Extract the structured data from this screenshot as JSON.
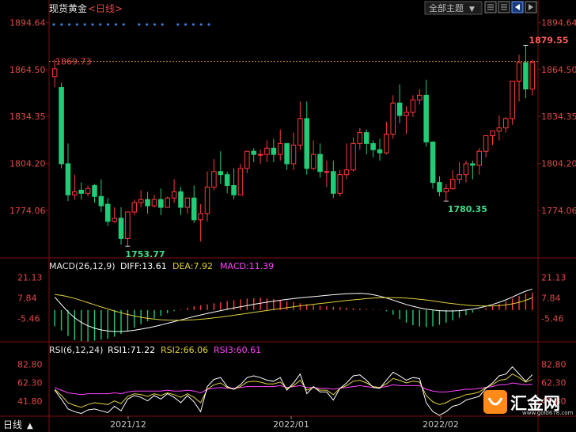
{
  "header": {
    "symbol": "现货黄金",
    "period": "<日线>",
    "theme_select": "全部主题",
    "theme_arrow": "▼"
  },
  "colors": {
    "up": "#ff3b3b",
    "down": "#22cc77",
    "axis_text": "#e04848",
    "dashed_ref": "#d88a30",
    "diff": "#ffffff",
    "dea": "#e0d040",
    "macd": "#ff44ff",
    "rsi1": "#ffffff",
    "rsi2": "#e0d040",
    "rsi3": "#ff44ff",
    "grid": "#7a1010",
    "blue_dots": "#3a78d8"
  },
  "price_panel": {
    "axis_labels": [
      "1894.64",
      "1864.50",
      "1834.35",
      "1804.20",
      "1774.06"
    ],
    "ref_label": "1869.73",
    "high_label": "1879.55",
    "low_label": "1753.77",
    "mid_low_label": "1780.35"
  },
  "macd_panel": {
    "title": "MACD(26,12,9)",
    "diff_label": "DIFF:13.61",
    "dea_label": "DEA:7.92",
    "macd_label": "MACD:11.39",
    "axis_labels": [
      "21.13",
      "7.84",
      "-5.46"
    ]
  },
  "rsi_panel": {
    "title": "RSI(6,12,24)",
    "rsi1_label": "RSI1:71.22",
    "rsi2_label": "RSI2:66.06",
    "rsi3_label": "RSI3:60.61",
    "axis_labels": [
      "82.80",
      "62.30",
      "41.80"
    ]
  },
  "xaxis": {
    "period_button": "日线",
    "period_arrow": "▲",
    "dates": [
      "2021/12",
      "2022/01",
      "2022/02"
    ]
  },
  "logo": {
    "name": "汇金网",
    "url": "www.gold678.com"
  },
  "chart_data": {
    "type": "candlestick",
    "price_range": [
      1744,
      1898
    ],
    "candles": [
      [
        1860,
        1871,
        1865,
        1853
      ],
      [
        1853,
        1856,
        1804,
        1801
      ],
      [
        1804,
        1817,
        1784,
        1780
      ],
      [
        1784,
        1797,
        1786,
        1781
      ],
      [
        1787,
        1792,
        1785,
        1781
      ],
      [
        1785,
        1790,
        1788,
        1783
      ],
      [
        1790,
        1791,
        1783,
        1779
      ],
      [
        1783,
        1794,
        1777,
        1773
      ],
      [
        1778,
        1782,
        1767,
        1764
      ],
      [
        1767,
        1776,
        1769,
        1766
      ],
      [
        1769,
        1776,
        1756,
        1752
      ],
      [
        1756,
        1772,
        1773,
        1751
      ],
      [
        1773,
        1781,
        1779,
        1771
      ],
      [
        1779,
        1787,
        1781,
        1776
      ],
      [
        1781,
        1786,
        1777,
        1772
      ],
      [
        1777,
        1784,
        1781,
        1776
      ],
      [
        1781,
        1788,
        1776,
        1771
      ],
      [
        1776,
        1783,
        1782,
        1776
      ],
      [
        1782,
        1794,
        1786,
        1779
      ],
      [
        1786,
        1789,
        1776,
        1771
      ],
      [
        1776,
        1778,
        1782,
        1772
      ],
      [
        1782,
        1790,
        1768,
        1766
      ],
      [
        1768,
        1778,
        1772,
        1754
      ],
      [
        1772,
        1799,
        1789,
        1767
      ],
      [
        1789,
        1807,
        1799,
        1787
      ],
      [
        1799,
        1812,
        1797,
        1791
      ],
      [
        1797,
        1799,
        1790,
        1785
      ],
      [
        1790,
        1801,
        1784,
        1781
      ],
      [
        1784,
        1804,
        1801,
        1784
      ],
      [
        1801,
        1811,
        1812,
        1798
      ],
      [
        1812,
        1814,
        1810,
        1805
      ],
      [
        1810,
        1813,
        1810,
        1804
      ],
      [
        1810,
        1819,
        1814,
        1805
      ],
      [
        1814,
        1820,
        1810,
        1805
      ],
      [
        1810,
        1826,
        1817,
        1806
      ],
      [
        1817,
        1817,
        1804,
        1800
      ],
      [
        1804,
        1824,
        1816,
        1800
      ],
      [
        1816,
        1844,
        1833,
        1813
      ],
      [
        1833,
        1844,
        1801,
        1797
      ],
      [
        1801,
        1819,
        1810,
        1800
      ],
      [
        1810,
        1817,
        1799,
        1795
      ],
      [
        1799,
        1806,
        1799,
        1789
      ],
      [
        1799,
        1806,
        1785,
        1782
      ],
      [
        1785,
        1800,
        1797,
        1783
      ],
      [
        1797,
        1817,
        1800,
        1794
      ],
      [
        1800,
        1821,
        1817,
        1799
      ],
      [
        1817,
        1827,
        1824,
        1813
      ],
      [
        1824,
        1826,
        1817,
        1810
      ],
      [
        1817,
        1819,
        1813,
        1808
      ],
      [
        1813,
        1820,
        1811,
        1806
      ],
      [
        1811,
        1831,
        1823,
        1810
      ],
      [
        1823,
        1848,
        1843,
        1820
      ],
      [
        1843,
        1855,
        1835,
        1830
      ],
      [
        1835,
        1841,
        1837,
        1823
      ],
      [
        1837,
        1848,
        1845,
        1834
      ],
      [
        1845,
        1852,
        1848,
        1842
      ],
      [
        1848,
        1858,
        1818,
        1815
      ],
      [
        1818,
        1818,
        1792,
        1788
      ],
      [
        1792,
        1796,
        1786,
        1783
      ],
      [
        1786,
        1791,
        1788,
        1780
      ],
      [
        1788,
        1800,
        1794,
        1787
      ],
      [
        1794,
        1805,
        1797,
        1791
      ],
      [
        1797,
        1806,
        1804,
        1792
      ],
      [
        1804,
        1806,
        1803,
        1794
      ],
      [
        1803,
        1814,
        1812,
        1797
      ],
      [
        1812,
        1821,
        1822,
        1808
      ],
      [
        1822,
        1824,
        1825,
        1816
      ],
      [
        1825,
        1835,
        1827,
        1819
      ],
      [
        1827,
        1834,
        1833,
        1824
      ],
      [
        1833,
        1855,
        1857,
        1829
      ],
      [
        1857,
        1874,
        1869,
        1844
      ],
      [
        1869,
        1880,
        1852,
        1846
      ],
      [
        1852,
        1871,
        1869,
        1848
      ]
    ],
    "macd": {
      "histogram": [
        -10.5,
        -13.2,
        -16.8,
        -19.5,
        -20.1,
        -20.4,
        -19.8,
        -19.2,
        -18.6,
        -17.3,
        -15.5,
        -13.6,
        -11.4,
        -9.2,
        -7.3,
        -5.4,
        -3.8,
        -2.1,
        -0.7,
        0.4,
        1.4,
        2.4,
        3.1,
        3.7,
        4.4,
        5.1,
        5.8,
        6.3,
        6.9,
        7.4,
        7.7,
        7.9,
        7.6,
        7.1,
        6.5,
        5.8,
        5.2,
        4.4,
        3.8,
        3.2,
        2.8,
        2.4,
        2.1,
        1.8,
        1.5,
        1.2,
        0.9,
        0.6,
        0.4,
        0.2,
        -0.8,
        -3.0,
        -5.8,
        -8.2,
        -9.8,
        -10.7,
        -11.0,
        -10.6,
        -9.6,
        -8.2,
        -6.7,
        -5.0,
        -3.3,
        -1.7,
        -0.2,
        1.2,
        2.6,
        4.0,
        5.6,
        7.4,
        9.2,
        10.5,
        11.39
      ],
      "diff": [
        8.4,
        3.5,
        -1.2,
        -5.0,
        -8.0,
        -10.2,
        -11.8,
        -12.9,
        -13.5,
        -13.9,
        -13.9,
        -13.6,
        -13.1,
        -12.4,
        -11.6,
        -10.7,
        -9.7,
        -8.6,
        -7.5,
        -6.4,
        -5.3,
        -4.2,
        -3.2,
        -2.2,
        -1.3,
        -0.4,
        0.5,
        1.3,
        2.1,
        2.9,
        3.7,
        4.4,
        5.1,
        5.7,
        6.3,
        6.9,
        7.4,
        7.9,
        8.3,
        8.7,
        9.1,
        9.5,
        9.9,
        10.2,
        10.5,
        10.7,
        10.8,
        10.5,
        9.9,
        9.0,
        7.8,
        6.4,
        5.0,
        3.6,
        2.4,
        1.4,
        0.6,
        0.0,
        -0.4,
        -0.6,
        -0.6,
        -0.4,
        0.0,
        0.6,
        1.4,
        2.4,
        3.6,
        5.0,
        6.6,
        8.4,
        10.4,
        12.2,
        13.61
      ],
      "dea": [
        10.0,
        9.5,
        8.6,
        7.5,
        6.2,
        4.8,
        3.4,
        2.0,
        0.7,
        -0.6,
        -1.8,
        -2.9,
        -3.9,
        -4.7,
        -5.4,
        -5.9,
        -6.3,
        -6.5,
        -6.6,
        -6.6,
        -6.5,
        -6.3,
        -6.0,
        -5.6,
        -5.1,
        -4.6,
        -4.0,
        -3.4,
        -2.8,
        -2.2,
        -1.5,
        -0.9,
        -0.3,
        0.3,
        0.9,
        1.5,
        2.1,
        2.7,
        3.2,
        3.7,
        4.2,
        4.7,
        5.2,
        5.7,
        6.2,
        6.6,
        7.0,
        7.4,
        7.7,
        7.9,
        8.0,
        8.0,
        7.9,
        7.7,
        7.4,
        7.0,
        6.5,
        5.9,
        5.3,
        4.7,
        4.1,
        3.6,
        3.2,
        2.9,
        2.7,
        2.6,
        2.7,
        2.9,
        3.3,
        4.0,
        5.0,
        6.3,
        7.92
      ],
      "range": [
        -17,
        24
      ]
    },
    "rsi": {
      "rsi1": [
        54,
        44,
        33,
        30,
        28,
        32,
        33,
        31,
        29,
        36,
        31,
        44,
        48,
        46,
        42,
        48,
        44,
        50,
        46,
        40,
        48,
        41,
        30,
        58,
        66,
        68,
        58,
        55,
        60,
        68,
        70,
        68,
        65,
        64,
        68,
        54,
        62,
        72,
        50,
        58,
        52,
        52,
        43,
        56,
        62,
        70,
        71,
        65,
        57,
        56,
        65,
        74,
        70,
        65,
        68,
        67,
        40,
        30,
        26,
        30,
        36,
        38,
        43,
        45,
        47,
        56,
        62,
        70,
        72,
        80,
        72,
        64,
        71.2
      ],
      "rsi2": [
        55,
        48,
        40,
        37,
        35,
        38,
        40,
        39,
        38,
        42,
        39,
        47,
        50,
        49,
        47,
        50,
        48,
        51,
        49,
        46,
        50,
        46,
        40,
        55,
        60,
        62,
        57,
        55,
        58,
        63,
        64,
        63,
        61,
        61,
        63,
        56,
        59,
        65,
        54,
        57,
        54,
        54,
        49,
        56,
        59,
        64,
        65,
        62,
        58,
        57,
        61,
        67,
        65,
        62,
        64,
        63,
        48,
        41,
        38,
        40,
        44,
        46,
        49,
        50,
        52,
        57,
        60,
        65,
        66,
        72,
        68,
        63,
        66.06
      ],
      "rsi3": [
        57,
        54,
        51,
        50,
        49,
        50,
        50,
        50,
        50,
        51,
        50,
        52,
        53,
        53,
        53,
        53,
        53,
        54,
        53,
        53,
        54,
        53,
        51,
        55,
        56,
        57,
        56,
        56,
        57,
        58,
        58,
        58,
        58,
        58,
        59,
        57,
        58,
        59,
        57,
        57,
        56,
        56,
        55,
        56,
        57,
        58,
        59,
        58,
        57,
        57,
        58,
        60,
        59,
        59,
        59,
        59,
        55,
        53,
        52,
        52,
        53,
        54,
        55,
        55,
        56,
        57,
        58,
        60,
        60,
        62,
        61,
        60,
        60.61
      ],
      "range": [
        25,
        92
      ]
    }
  }
}
